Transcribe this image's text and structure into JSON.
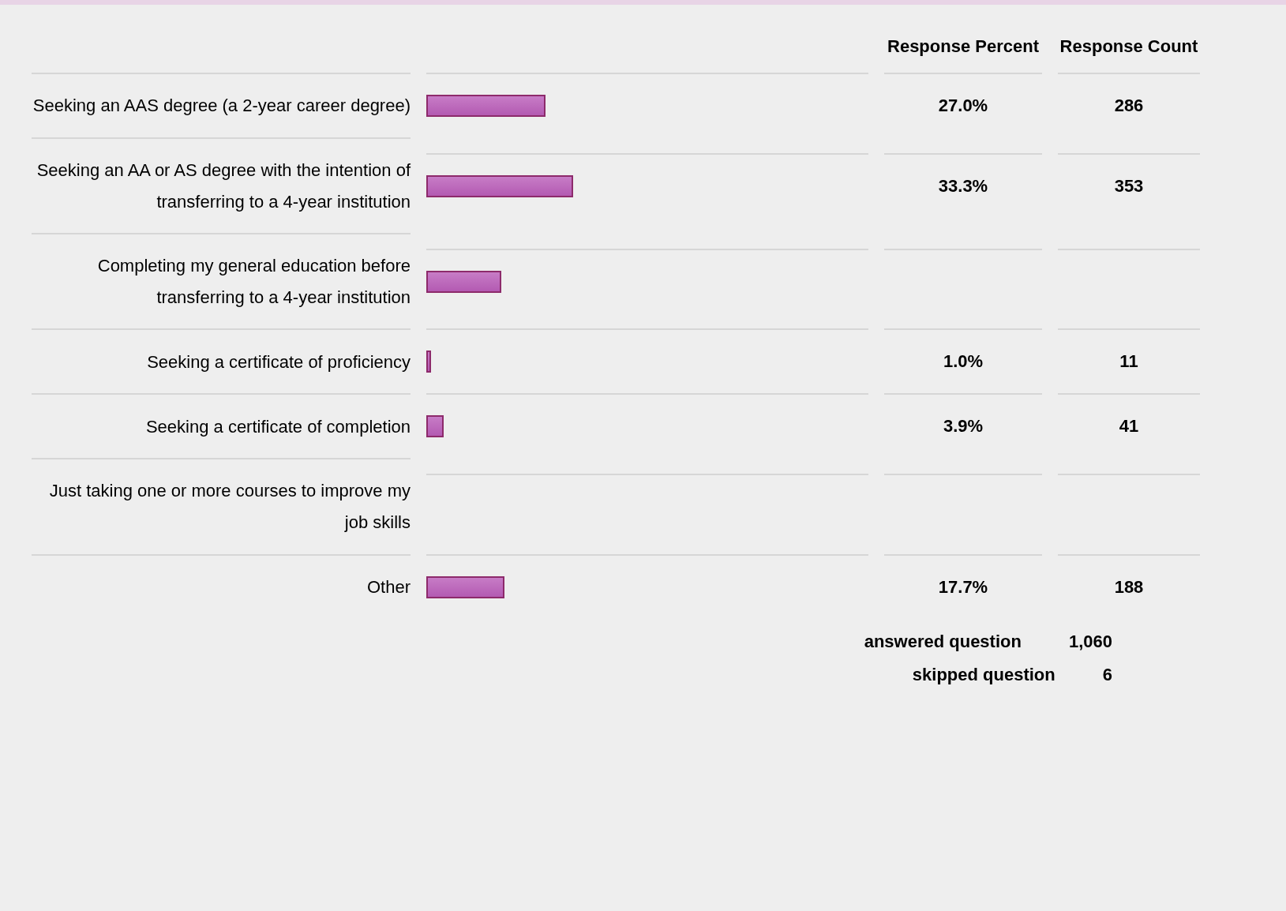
{
  "columns": {
    "percent": "Response Percent",
    "count": "Response Count"
  },
  "rows": [
    {
      "label": "Seeking an AAS degree (a 2-year career degree)",
      "level": 0.27,
      "percent": "27.0%",
      "count": "286"
    },
    {
      "label": "Seeking an AA or AS degree with the intention of transferring to a 4-year institution",
      "level": 0.333,
      "percent": "33.3%",
      "count": "353"
    },
    {
      "label": "Completing my general education before transferring to a 4-year institution",
      "level": 0.17
    },
    {
      "label": "Seeking a certificate of proficiency",
      "level": 0.01,
      "percent": "1.0%",
      "count": "11"
    },
    {
      "label": "Seeking a certificate of completion",
      "level": 0.039,
      "percent": "3.9%",
      "count": "41"
    },
    {
      "label": "Just taking one or more courses to improve my job skills",
      "level": 0.0
    },
    {
      "label": "Other",
      "level": 0.177,
      "percent": "17.7%",
      "count": "188"
    }
  ],
  "answered": {
    "label": "answered question",
    "count": "1,060"
  },
  "skipped": {
    "label": "skipped question",
    "count": "6"
  }
}
